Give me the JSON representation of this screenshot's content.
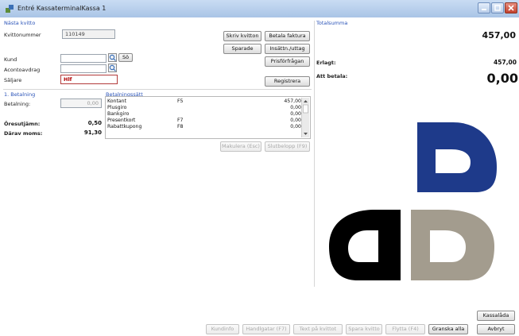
{
  "window": {
    "title": "Entré KassaterminalKassa 1"
  },
  "receipt": {
    "section_label": "Nästa kvitto",
    "number_label": "Kvittonummer",
    "number_value": "110149",
    "customer_label": "Kund",
    "customer_value": "",
    "advance_label": "Acontoavdrag",
    "advance_value": "",
    "seller_label": "Säljare",
    "seller_value": "Hlf",
    "sok_label": "Sö"
  },
  "actions": {
    "print_receipt": "Skriv kvitton",
    "pay_invoice": "Betala faktura",
    "save": "Sparade",
    "cash_in_out": "Insättn./uttag",
    "price_inquiry": "Prisförfrågan",
    "register": "Registrera"
  },
  "payment": {
    "section_label": "1. Betalning",
    "payment_label": "Betalning:",
    "payment_value": "0,00",
    "rounding_label": "Öresutjämn:",
    "rounding_value": "0,50",
    "vat_label": "Därav moms:",
    "vat_value": "91,30"
  },
  "payment_methods": {
    "section_label": "Betalningssätt",
    "rows": [
      {
        "name": "Kontant",
        "key": "F5",
        "amount": "457,00"
      },
      {
        "name": "Plusgiro",
        "key": "",
        "amount": "0,00"
      },
      {
        "name": "Bankgiro",
        "key": "",
        "amount": "0,00"
      },
      {
        "name": "Presentkort",
        "key": "F7",
        "amount": "0,00"
      },
      {
        "name": "Rabattkupong",
        "key": "F8",
        "amount": "0,00"
      }
    ],
    "cancel_button": "Makulera (Esc)",
    "subtotal_button": "Slutbelopp (F9)"
  },
  "totals": {
    "section_label": "Totalsumma",
    "total_value": "457,00",
    "paid_label": "Erlagt:",
    "paid_value": "457,00",
    "to_pay_label": "Att betala:",
    "to_pay_value": "0,00"
  },
  "bottom": {
    "kassalada": "Kassalåda",
    "buttons": [
      {
        "label": "Kundinfo",
        "enabled": false
      },
      {
        "label": "Handlgatar (F7)",
        "enabled": false
      },
      {
        "label": "Text på kvittot",
        "enabled": false
      },
      {
        "label": "Spara kvitto",
        "enabled": false
      },
      {
        "label": "Flytta (F4)",
        "enabled": false
      },
      {
        "label": "Granska alla",
        "enabled": true
      },
      {
        "label": "Avbryt",
        "enabled": true
      }
    ]
  },
  "colors": {
    "accent_blue": "#2a53b8",
    "logo_blue": "#1e3a8a",
    "logo_black": "#000000",
    "logo_gray": "#a39c8e"
  },
  "icons": {
    "app": "app-icon",
    "minimize": "minimize-icon",
    "maximize": "maximize-icon",
    "close": "close-icon",
    "lookup": "lookup-icon"
  }
}
